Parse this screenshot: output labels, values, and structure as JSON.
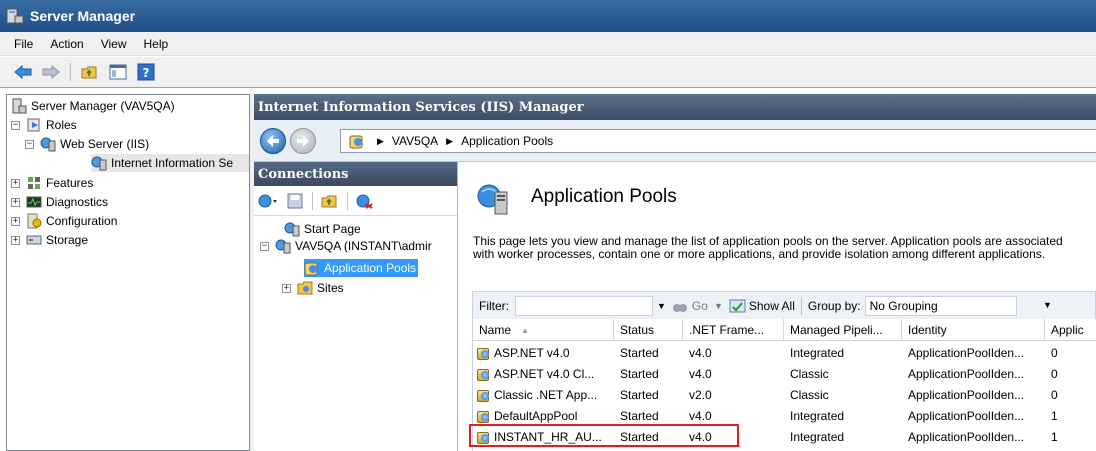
{
  "window": {
    "title": "Server Manager"
  },
  "menu": [
    "File",
    "Action",
    "View",
    "Help"
  ],
  "tree": {
    "root": "Server Manager (VAV5QA)",
    "roles": "Roles",
    "web_server": "Web Server (IIS)",
    "iis": "Internet Information Se",
    "features": "Features",
    "diagnostics": "Diagnostics",
    "configuration": "Configuration",
    "storage": "Storage"
  },
  "iis": {
    "header": "Internet Information Services (IIS) Manager",
    "breadcrumb": [
      "VAV5QA",
      "Application Pools"
    ]
  },
  "connections": {
    "header": "Connections",
    "start_page": "Start Page",
    "server": "VAV5QA (INSTANT\\admir",
    "app_pools": "Application Pools",
    "sites": "Sites"
  },
  "page": {
    "title": "Application Pools",
    "description": "This page lets you view and manage the list of application pools on the server. Application pools are associated with worker processes, contain one or more applications, and provide isolation among different applications."
  },
  "filter": {
    "label": "Filter:",
    "go": "Go",
    "show_all": "Show All",
    "group_by_label": "Group by:",
    "group_by_value": "No Grouping"
  },
  "grid": {
    "columns": [
      "Name",
      "Status",
      ".NET Frame...",
      "Managed Pipeli...",
      "Identity",
      "Applic"
    ],
    "rows": [
      [
        "ASP.NET v4.0",
        "Started",
        "v4.0",
        "Integrated",
        "ApplicationPoolIden...",
        "0"
      ],
      [
        "ASP.NET v4.0 Cl...",
        "Started",
        "v4.0",
        "Classic",
        "ApplicationPoolIden...",
        "0"
      ],
      [
        "Classic .NET App...",
        "Started",
        "v2.0",
        "Classic",
        "ApplicationPoolIden...",
        "0"
      ],
      [
        "DefaultAppPool",
        "Started",
        "v4.0",
        "Integrated",
        "ApplicationPoolIden...",
        "1"
      ],
      [
        "INSTANT_HR_AU...",
        "Started",
        "v4.0",
        "Integrated",
        "ApplicationPoolIden...",
        "1"
      ]
    ]
  },
  "colors": {
    "highlight": "#e02020",
    "selection": "#3399ff",
    "title_bar": "#2a5a94"
  }
}
